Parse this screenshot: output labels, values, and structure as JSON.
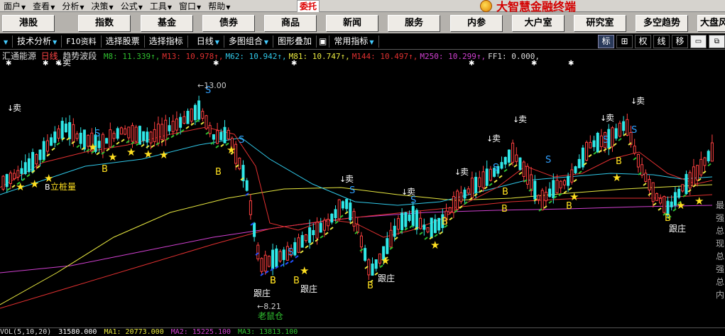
{
  "menubar": {
    "items": [
      {
        "label": "面户",
        "arrow": "▼"
      },
      {
        "label": "查看",
        "arrow": "▼"
      },
      {
        "label": "分析",
        "arrow": "▼"
      },
      {
        "label": "决策",
        "arrow": "▼"
      },
      {
        "label": "公式",
        "arrow": "▼"
      },
      {
        "label": "工具",
        "arrow": "▼"
      },
      {
        "label": "窗口",
        "arrow": "▼"
      },
      {
        "label": "帮助",
        "arrow": "▼"
      }
    ],
    "weituo": "委托",
    "brand": "大智慧金融终端"
  },
  "nav": {
    "buttons": [
      "港股",
      "指数",
      "基金",
      "债券",
      "商品",
      "新闻",
      "服务",
      "内参",
      "大户室",
      "研究室",
      "多空趋势",
      "大盘风"
    ]
  },
  "toolbar": {
    "items": [
      {
        "label": "技术分析",
        "drop": "▼"
      },
      {
        "label": "F10资料",
        "drop": ""
      },
      {
        "label": "选择股票",
        "drop": ""
      },
      {
        "label": "选择指标",
        "drop": ""
      },
      {
        "label": "日线",
        "drop": "▼"
      },
      {
        "label": "多图组合",
        "drop": "▼"
      },
      {
        "label": "图形叠加",
        "drop": ""
      },
      {
        "label": "常用指标",
        "drop": "▼"
      }
    ],
    "right": [
      "标",
      "⊞",
      "权",
      "线",
      "移",
      "▭",
      "⧉"
    ]
  },
  "info": {
    "stock": "汇通能源",
    "period": "日线",
    "indicator": "趋势波段",
    "ma": [
      {
        "text": "M8: 11.339",
        "arrow": "↑",
        "color": "#30c030"
      },
      {
        "text": "M13: 10.978",
        "arrow": "↑",
        "color": "#e03030"
      },
      {
        "text": "M62: 10.942",
        "arrow": "↑",
        "color": "#30c8e8"
      },
      {
        "text": "M81: 10.747",
        "arrow": "↑",
        "color": "#e8e840"
      },
      {
        "text": "M144: 10.497",
        "arrow": "↑",
        "color": "#e03030"
      },
      {
        "text": "M250: 10.299",
        "arrow": "↑",
        "color": "#d040d0"
      },
      {
        "text": "FF1: 0.000,",
        "arrow": "",
        "color": "#dddddd"
      }
    ]
  },
  "chart": {
    "labels": {
      "sell": "卖",
      "buy": "B",
      "sell_s": "S",
      "genzhuang": "跟庄",
      "lishuang": "立桩量",
      "laoshucang": "老鼠仓",
      "high_price": "13.00",
      "low_price": "8.21"
    }
  },
  "rightpanel": {
    "chars": [
      "最",
      "强",
      "总",
      "现",
      "总",
      "强",
      "总",
      "内"
    ]
  },
  "bottom": {
    "items": [
      {
        "text": "VOL(5,10,20)",
        "color": "#dddddd"
      },
      {
        "text": "31580.000",
        "color": "#ffffff"
      },
      {
        "text": "MA1: 20773.000",
        "color": "#e8e840"
      },
      {
        "text": "MA2: 15225.100",
        "color": "#d040d0"
      },
      {
        "text": "MA3: 13813.100",
        "color": "#30c030"
      }
    ]
  },
  "colors": {
    "up": "#30e8e8",
    "down": "#ff4040",
    "bg": "#000000",
    "star": "#ffe020"
  }
}
